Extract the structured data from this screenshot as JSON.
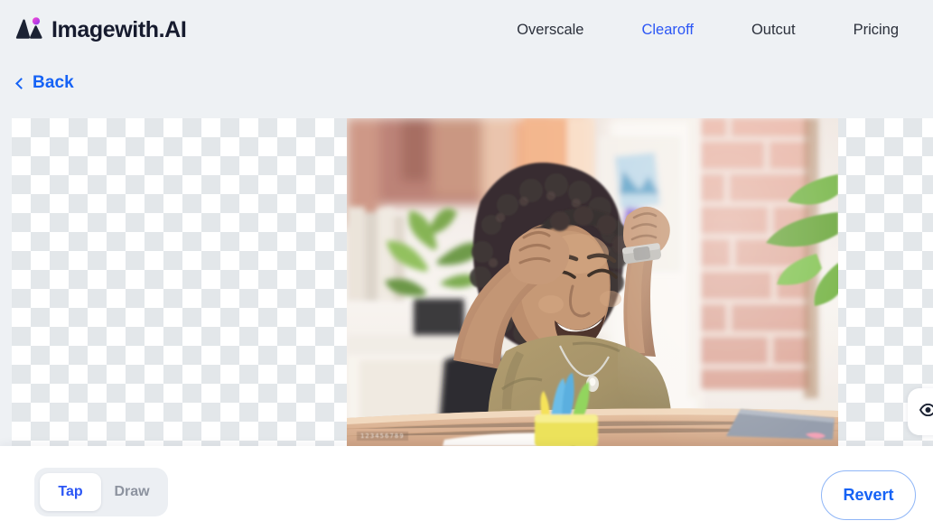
{
  "header": {
    "brand_name": "Imagewith.AI",
    "logo_icon": "mountains-logo-icon",
    "nav": [
      {
        "label": "Overscale",
        "active": false
      },
      {
        "label": "Clearoff",
        "active": true
      },
      {
        "label": "Outcut",
        "active": false
      },
      {
        "label": "Pricing",
        "active": false
      }
    ]
  },
  "back": {
    "label": "Back",
    "icon": "chevron-left-icon"
  },
  "canvas": {
    "transparency_pattern": "checkerboard",
    "checker_light": "#ffffff",
    "checker_dark": "#e3e7ea",
    "photo_alt": "Smiling woman with curly hair celebrating with raised fists at a desk",
    "watermark": "123456789"
  },
  "preview_toggle": {
    "icon": "eye-icon",
    "label": ""
  },
  "bottom_bar": {
    "modes": [
      {
        "label": "Tap",
        "active": true
      },
      {
        "label": "Draw",
        "active": false
      }
    ],
    "revert_label": "Revert"
  },
  "colors": {
    "accent_blue": "#2b56f5",
    "link_blue": "#1562f5",
    "page_bg": "#eef1f4",
    "panel_bg": "#ffffff",
    "muted_text": "#8d939f",
    "logo_dot_start": "#ff4fd8",
    "logo_dot_end": "#7a3df0"
  }
}
